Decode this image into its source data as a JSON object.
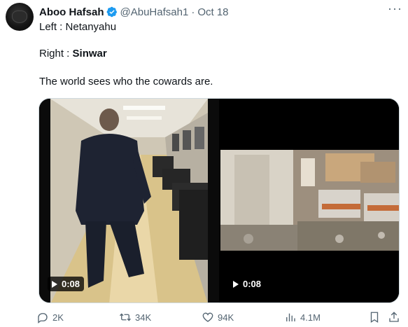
{
  "tweet": {
    "author_name": "Aboo Hafsah",
    "handle": "@AbuHafsah1",
    "separator": "·",
    "date": "Oct 18",
    "more": "···",
    "line1": "Left : Netanyahu",
    "line2_prefix": "Right : ",
    "line2_bold": "Sinwar",
    "line3": "The world sees who the cowards are."
  },
  "media": {
    "left_video": {
      "duration": "0:08"
    },
    "right_video": {
      "duration": "0:08"
    }
  },
  "actions": {
    "replies": "2K",
    "reposts": "34K",
    "likes": "94K",
    "views": "4.1M"
  },
  "colors": {
    "text": "#0f1419",
    "muted": "#536471",
    "verified": "#1d9bf0"
  },
  "icons": [
    "verified-badge-icon",
    "more-icon",
    "play-icon",
    "reply-icon",
    "repost-icon",
    "like-icon",
    "views-icon",
    "bookmark-icon",
    "share-icon"
  ]
}
